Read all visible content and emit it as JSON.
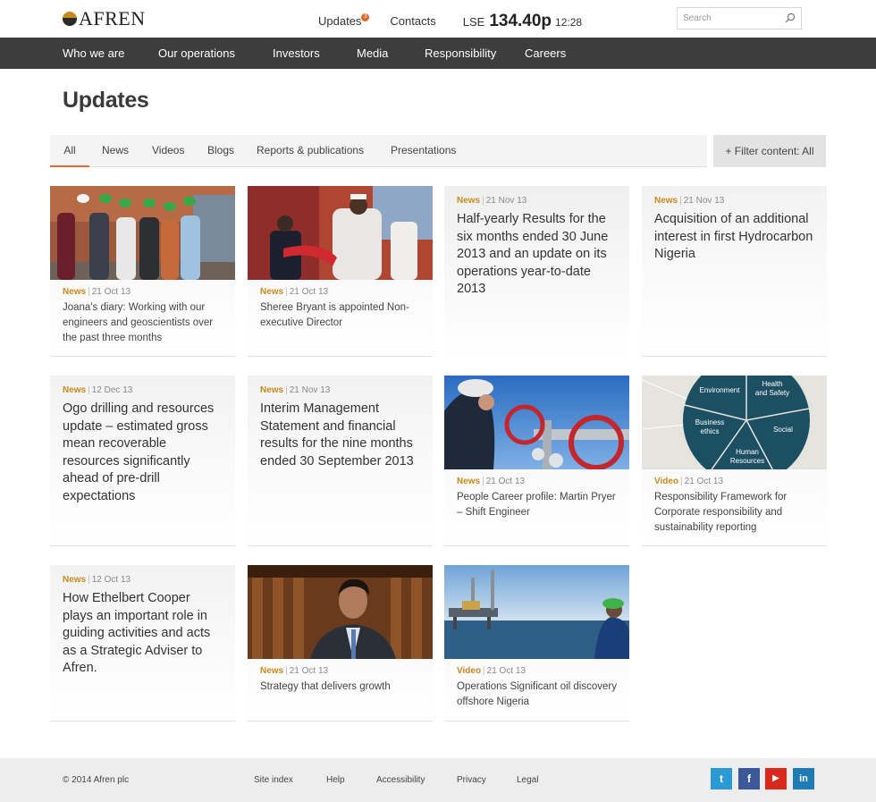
{
  "brand": {
    "name": "AFREN"
  },
  "top": {
    "updates_label": "Updates",
    "updates_badge": "3",
    "contacts_label": "Contacts",
    "lse_label": "LSE",
    "lse_price": "134.40p",
    "lse_time": "12:28",
    "search_placeholder": "Search"
  },
  "nav": [
    "Who we are",
    "Our operations",
    "Investors",
    "Media",
    "Responsibility",
    "Careers"
  ],
  "page": {
    "title": "Updates"
  },
  "tabs": [
    "All",
    "News",
    "Videos",
    "Blogs",
    "Reports & publications",
    "Presentations"
  ],
  "filter_label": "+ Filter content: All",
  "cards": [
    {
      "type": "News",
      "date": "21 Oct 13",
      "title": "Joana's diary: Working with our engineers and geoscientists over the past three months",
      "image": "field-engineers-photo"
    },
    {
      "type": "News",
      "date": "21 Oct 13",
      "title": "Sheree Bryant is appointed Non-executive Director",
      "image": "ribbon-cutting-photo"
    },
    {
      "type": "News",
      "date": "21 Nov 13",
      "title": "Half-yearly Results for the six months ended 30 June 2013 and an update on its operations year-to-date 2013"
    },
    {
      "type": "News",
      "date": "21 Nov 13",
      "title": "Acquisition of an additional interest in first Hydrocarbon Nigeria"
    },
    {
      "type": "News",
      "date": "12 Dec 13",
      "title": "Ogo drilling and resources update – estimated gross mean recoverable resources significantly ahead of pre-drill expectations"
    },
    {
      "type": "News",
      "date": "21 Nov 13",
      "title": "Interim Management Statement and financial results for the nine months ended 30 September 2013"
    },
    {
      "type": "News",
      "date": "21 Oct 13",
      "title": "People Career profile: Martin Pryer – Shift Engineer",
      "image": "valve-engineer-photo"
    },
    {
      "type": "Video",
      "date": "21 Oct 13",
      "title": "Responsibility Framework for Corporate responsibility and sustainability reporting",
      "image": "responsibility-wheel-diagram",
      "wheel_labels": [
        "Environment",
        "Health and Safety",
        "Business ethics",
        "Social",
        "Human Resources"
      ]
    },
    {
      "type": "News",
      "date": "12 Oct 13",
      "title": "How Ethelbert Cooper plays an important role in guiding activities and acts as a Strategic Adviser to Afren."
    },
    {
      "type": "News",
      "date": "21 Oct 13",
      "title": "Strategy that delivers growth",
      "image": "executive-portrait-photo"
    },
    {
      "type": "Video",
      "date": "21 Oct 13",
      "title": "Operations Significant oil discovery offshore Nigeria",
      "image": "offshore-rig-photo"
    }
  ],
  "footer": {
    "copyright": "© 2014 Afren plc",
    "links": [
      "Site index",
      "Help",
      "Accessibility",
      "Privacy",
      "Legal"
    ],
    "social": [
      {
        "name": "twitter-icon",
        "glyph": "t",
        "color": "#2b9bd6"
      },
      {
        "name": "facebook-icon",
        "glyph": "f",
        "color": "#3b5998"
      },
      {
        "name": "youtube-icon",
        "glyph": "▶",
        "color": "#d9291f"
      },
      {
        "name": "linkedin-icon",
        "glyph": "in",
        "color": "#1f7bb6"
      }
    ]
  },
  "colors": {
    "accent": "#e06a2c",
    "meta_type": "#c8891e",
    "nav_bg": "#3d3d3d",
    "wheel": "#1d4f63"
  }
}
